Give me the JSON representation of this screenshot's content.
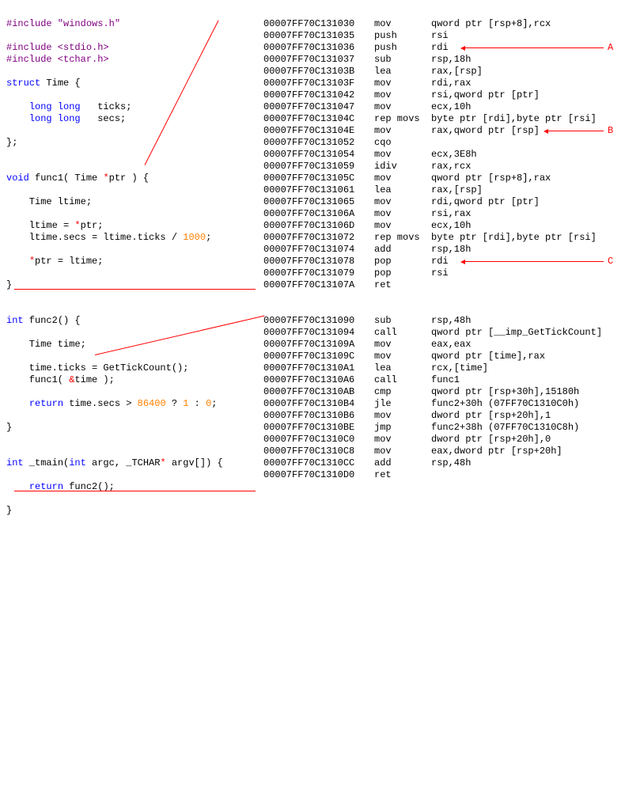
{
  "source": {
    "inc1": "#include \"windows.h\"",
    "inc2": "#include <stdio.h>",
    "inc3": "#include <tchar.h>",
    "struct_kw": "struct",
    "struct_name": " Time {",
    "ll1a": "long long",
    "ll1b": "   ticks;",
    "ll2a": "long long",
    "ll2b": "   secs;",
    "close1": "};",
    "void_kw": "void",
    "func1_sig_a": " func1( Time ",
    "star": "*",
    "func1_sig_b": "ptr ) {",
    "ltime_decl": "    Time ltime;",
    "ltime_assign_a": "    ltime = ",
    "ltime_assign_b": "ptr;",
    "ltime_secs": "    ltime.secs = ltime.ticks / ",
    "thousand": "1000",
    "semicolon": ";",
    "ptr_assign_a": "    ",
    "ptr_assign_b": "ptr = ltime;",
    "close_brace": "}",
    "int_kw": "int",
    "func2_sig": " func2() {",
    "time_decl": "    Time time;",
    "time_ticks": "    time.ticks = GetTickCount();",
    "func1_call_a": "    func1( ",
    "amp": "&",
    "func1_call_b": "time );",
    "return_kw": "return",
    "return_body_a": " time.secs > ",
    "num86400": "86400",
    "return_body_b": " ? ",
    "one": "1",
    "return_body_c": " : ",
    "zero": "0",
    "tmain_a": " _tmain(",
    "tmain_b": " argc, _TCHAR",
    "tmain_c": " argv[]) {",
    "ret_func2_a": " func2();"
  },
  "asm1": [
    {
      "addr": "00007FF70C131030",
      "mn": "mov",
      "ops": "qword ptr [rsp+8],rcx"
    },
    {
      "addr": "00007FF70C131035",
      "mn": "push",
      "ops": "rsi"
    },
    {
      "addr": "00007FF70C131036",
      "mn": "push",
      "ops": "rdi"
    },
    {
      "addr": "00007FF70C131037",
      "mn": "sub",
      "ops": "rsp,18h"
    },
    {
      "addr": "00007FF70C13103B",
      "mn": "lea",
      "ops": "rax,[rsp]"
    },
    {
      "addr": "00007FF70C13103F",
      "mn": "mov",
      "ops": "rdi,rax"
    },
    {
      "addr": "00007FF70C131042",
      "mn": "mov",
      "ops": "rsi,qword ptr [ptr]"
    },
    {
      "addr": "00007FF70C131047",
      "mn": "mov",
      "ops": "ecx,10h"
    },
    {
      "addr": "00007FF70C13104C",
      "mn": "rep movs",
      "ops": "byte ptr [rdi],byte ptr [rsi]"
    },
    {
      "addr": "00007FF70C13104E",
      "mn": "mov",
      "ops": "rax,qword ptr [rsp]"
    },
    {
      "addr": "00007FF70C131052",
      "mn": "cqo",
      "ops": ""
    },
    {
      "addr": "00007FF70C131054",
      "mn": "mov",
      "ops": "ecx,3E8h"
    },
    {
      "addr": "00007FF70C131059",
      "mn": "idiv",
      "ops": "rax,rcx"
    },
    {
      "addr": "00007FF70C13105C",
      "mn": "mov",
      "ops": "qword ptr [rsp+8],rax"
    },
    {
      "addr": "00007FF70C131061",
      "mn": "lea",
      "ops": "rax,[rsp]"
    },
    {
      "addr": "00007FF70C131065",
      "mn": "mov",
      "ops": "rdi,qword ptr [ptr]"
    },
    {
      "addr": "00007FF70C13106A",
      "mn": "mov",
      "ops": "rsi,rax"
    },
    {
      "addr": "00007FF70C13106D",
      "mn": "mov",
      "ops": "ecx,10h"
    },
    {
      "addr": "00007FF70C131072",
      "mn": "rep movs",
      "ops": "byte ptr [rdi],byte ptr [rsi]"
    },
    {
      "addr": "00007FF70C131074",
      "mn": "add",
      "ops": "rsp,18h"
    },
    {
      "addr": "00007FF70C131078",
      "mn": "pop",
      "ops": "rdi"
    },
    {
      "addr": "00007FF70C131079",
      "mn": "pop",
      "ops": "rsi"
    },
    {
      "addr": "00007FF70C13107A",
      "mn": "ret",
      "ops": ""
    }
  ],
  "asm2": [
    {
      "addr": "00007FF70C131090",
      "mn": "sub",
      "ops": "rsp,48h"
    },
    {
      "addr": "00007FF70C131094",
      "mn": "call",
      "ops": "qword ptr [__imp_GetTickCount]"
    },
    {
      "addr": "00007FF70C13109A",
      "mn": "mov",
      "ops": "eax,eax"
    },
    {
      "addr": "00007FF70C13109C",
      "mn": "mov",
      "ops": "qword ptr [time],rax"
    },
    {
      "addr": "00007FF70C1310A1",
      "mn": "lea",
      "ops": "rcx,[time]"
    },
    {
      "addr": "00007FF70C1310A6",
      "mn": "call",
      "ops": "func1"
    },
    {
      "addr": "00007FF70C1310AB",
      "mn": "cmp",
      "ops": "qword ptr [rsp+30h],15180h"
    },
    {
      "addr": "00007FF70C1310B4",
      "mn": "jle",
      "ops": "func2+30h (07FF70C1310C0h)"
    },
    {
      "addr": "00007FF70C1310B6",
      "mn": "mov",
      "ops": "dword ptr [rsp+20h],1"
    },
    {
      "addr": "00007FF70C1310BE",
      "mn": "jmp",
      "ops": "func2+38h (07FF70C1310C8h)"
    },
    {
      "addr": "00007FF70C1310C0",
      "mn": "mov",
      "ops": "dword ptr [rsp+20h],0"
    },
    {
      "addr": "00007FF70C1310C8",
      "mn": "mov",
      "ops": "eax,dword ptr [rsp+20h]"
    },
    {
      "addr": "00007FF70C1310CC",
      "mn": "add",
      "ops": "rsp,48h"
    },
    {
      "addr": "00007FF70C1310D0",
      "mn": "ret",
      "ops": ""
    }
  ],
  "markers": {
    "a": "A",
    "b": "B",
    "c": "C"
  }
}
